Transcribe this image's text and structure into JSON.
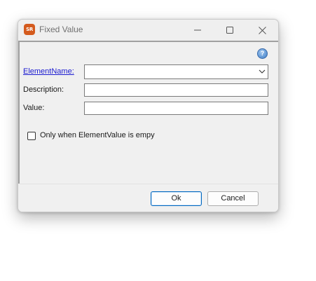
{
  "window": {
    "title": "Fixed Value",
    "icon_text": "SR",
    "icons": {
      "app": "sr-app-icon",
      "minimize": "minimize-icon",
      "maximize": "maximize-icon",
      "close": "close-icon",
      "help": "help-icon"
    }
  },
  "form": {
    "element_name_label": "ElementName:",
    "element_name_value": "",
    "description_label": "Description:",
    "description_value": "",
    "value_label": "Value:",
    "value_value": "",
    "only_when_empty_label": "Only when ElementValue is empy",
    "only_when_empty_checked": false
  },
  "buttons": {
    "ok": "Ok",
    "cancel": "Cancel"
  },
  "colors": {
    "link": "#1a1ad0",
    "default_button_border": "#0067c0",
    "app_icon": "#d45b1e"
  }
}
